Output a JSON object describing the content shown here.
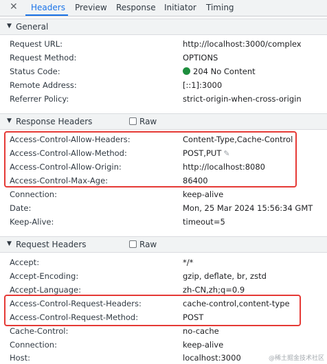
{
  "tabs": {
    "close": "✕",
    "items": [
      "Headers",
      "Preview",
      "Response",
      "Initiator",
      "Timing"
    ]
  },
  "general": {
    "title": "General",
    "rows": [
      {
        "key": "Request URL:",
        "value": "http://localhost:3000/complex"
      },
      {
        "key": "Request Method:",
        "value": "OPTIONS"
      },
      {
        "key": "Status Code:",
        "value": "204 No Content"
      },
      {
        "key": "Remote Address:",
        "value": "[::1]:3000"
      },
      {
        "key": "Referrer Policy:",
        "value": "strict-origin-when-cross-origin"
      }
    ]
  },
  "response_headers": {
    "title": "Response Headers",
    "raw_label": "Raw",
    "rows": [
      {
        "key": "Access-Control-Allow-Headers:",
        "value": "Content-Type,Cache-Control"
      },
      {
        "key": "Access-Control-Allow-Method:",
        "value": "POST,PUT"
      },
      {
        "key": "Access-Control-Allow-Origin:",
        "value": "http://localhost:8080"
      },
      {
        "key": "Access-Control-Max-Age:",
        "value": "86400"
      },
      {
        "key": "Connection:",
        "value": "keep-alive"
      },
      {
        "key": "Date:",
        "value": "Mon, 25 Mar 2024 15:56:34 GMT"
      },
      {
        "key": "Keep-Alive:",
        "value": "timeout=5"
      }
    ]
  },
  "request_headers": {
    "title": "Request Headers",
    "raw_label": "Raw",
    "rows": [
      {
        "key": "Accept:",
        "value": "*/*"
      },
      {
        "key": "Accept-Encoding:",
        "value": "gzip, deflate, br, zstd"
      },
      {
        "key": "Accept-Language:",
        "value": "zh-CN,zh;q=0.9"
      },
      {
        "key": "Access-Control-Request-Headers:",
        "value": "cache-control,content-type"
      },
      {
        "key": "Access-Control-Request-Method:",
        "value": "POST"
      },
      {
        "key": "Cache-Control:",
        "value": "no-cache"
      },
      {
        "key": "Connection:",
        "value": "keep-alive"
      },
      {
        "key": "Host:",
        "value": "localhost:3000"
      }
    ]
  },
  "watermark": "@稀土掘金技术社区",
  "colors": {
    "accent": "#1a73e8",
    "status_ok": "#1e8e3e",
    "highlight": "#e53935"
  },
  "icons": {
    "section_toggle": "triangle-down-icon",
    "edit": "pencil-icon"
  }
}
